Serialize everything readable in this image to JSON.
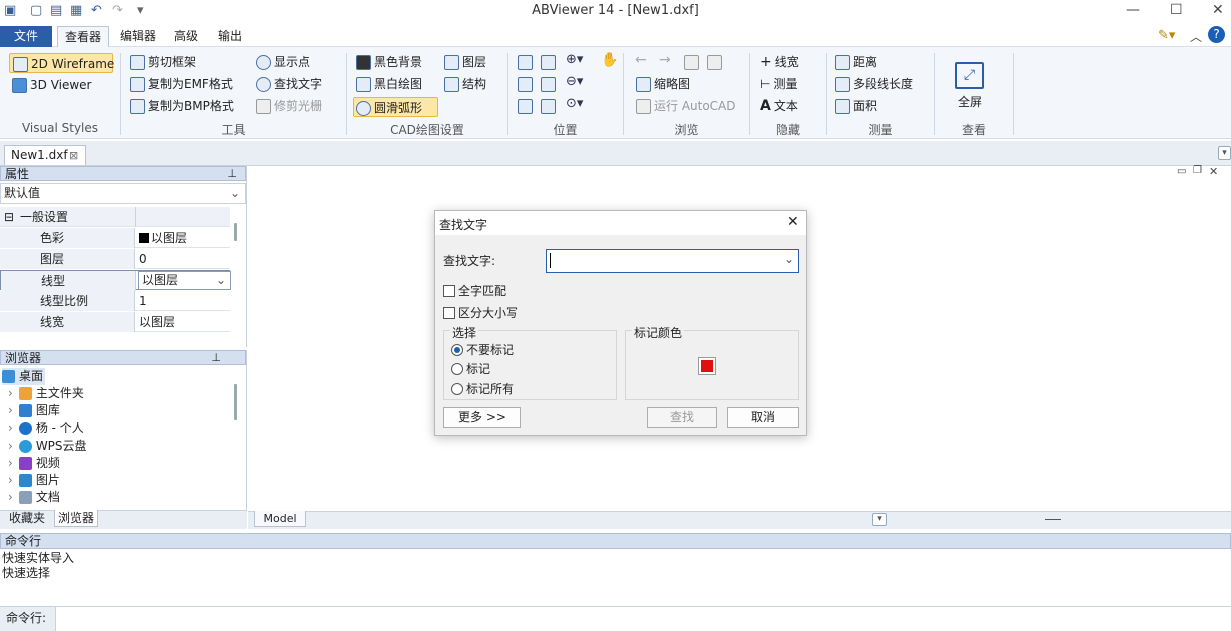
{
  "window": {
    "title": "ABViewer 14 - [New1.dxf]"
  },
  "menu": {
    "file": "文件",
    "tabs": [
      "查看器",
      "编辑器",
      "高级",
      "输出"
    ]
  },
  "ribbon": {
    "visual_styles": {
      "wireframe": "2D Wireframe",
      "viewer3d": "3D Viewer",
      "label": "Visual Styles"
    },
    "tools": {
      "clip_frame": "剪切框架",
      "copy_emf": "复制为EMF格式",
      "copy_bmp": "复制为BMP格式",
      "show_point": "显示点",
      "find_text": "查找文字",
      "trim_raster": "修剪光栅",
      "label": "工具"
    },
    "cad_settings": {
      "black_bg": "黑色背景",
      "bw_draw": "黑白绘图",
      "smooth_arc": "圆滑弧形",
      "layers": "图层",
      "structure": "结构",
      "label": "CAD绘图设置"
    },
    "position": {
      "label": "位置"
    },
    "browse": {
      "thumbnail": "缩略图",
      "run_autocad": "运行 AutoCAD",
      "label": "浏览"
    },
    "hide": {
      "line_width": "线宽",
      "measure": "测量",
      "text": "文本",
      "label": "隐藏"
    },
    "measure": {
      "distance": "距离",
      "polyline_length": "多段线长度",
      "area": "面积",
      "label": "测量"
    },
    "view": {
      "fullscreen": "全屏",
      "label": "查看"
    }
  },
  "doc_tab": {
    "name": "New1.dxf"
  },
  "properties": {
    "title": "属性",
    "selector": "默认值",
    "section": "一般设置",
    "rows": [
      {
        "name": "色彩",
        "value": "以图层"
      },
      {
        "name": "图层",
        "value": "0"
      },
      {
        "name": "线型",
        "value": "以图层"
      },
      {
        "name": "线型比例",
        "value": "1"
      },
      {
        "name": "线宽",
        "value": "以图层"
      }
    ]
  },
  "browser": {
    "title": "浏览器",
    "root": "桌面",
    "items": [
      "主文件夹",
      "图库",
      "杨 - 个人",
      "WPS云盘",
      "视频",
      "图片",
      "文档"
    ],
    "tabs": [
      "收藏夹",
      "浏览器"
    ]
  },
  "model_tab": "Model",
  "command": {
    "title": "命令行",
    "output": [
      "快速实体导入",
      "快速选择"
    ],
    "prompt": "命令行:"
  },
  "dialog": {
    "title": "查找文字",
    "find_label": "查找文字:",
    "find_value": "",
    "whole_word": "全字匹配",
    "match_case": "区分大小写",
    "select_group": "选择",
    "options": [
      "不要标记",
      "标记",
      "标记所有"
    ],
    "mark_color_label": "标记颜色",
    "mark_color": "#e01010",
    "more_button": "更多 >>",
    "find_button": "查找",
    "cancel_button": "取消"
  }
}
